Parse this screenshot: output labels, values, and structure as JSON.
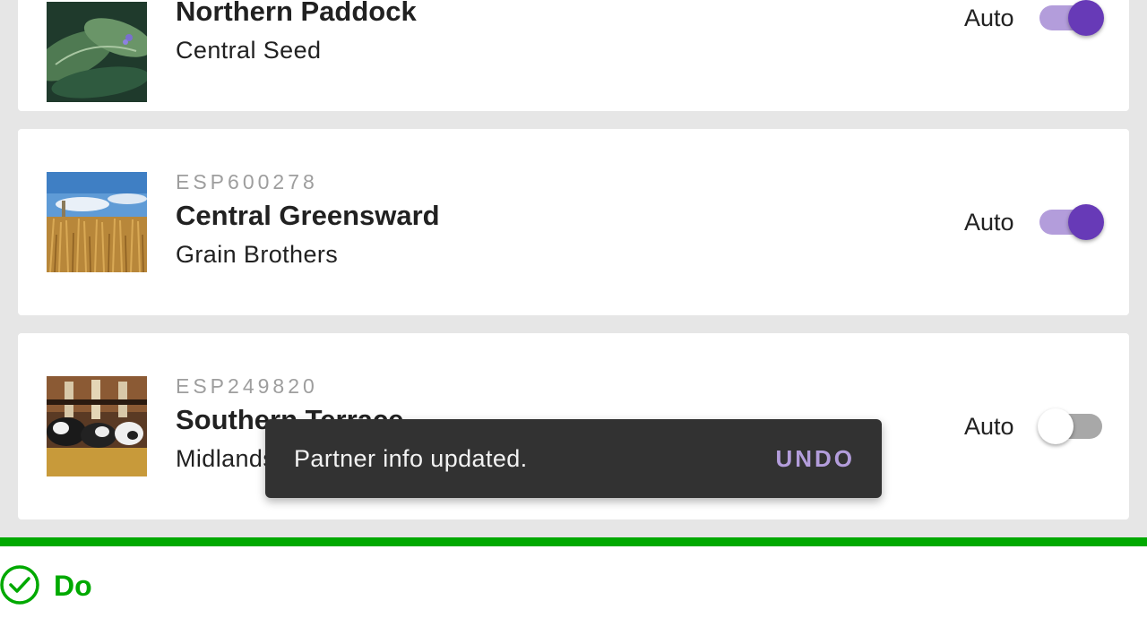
{
  "cards": [
    {
      "code": "",
      "name": "Northern Paddock",
      "company": "Central Seed",
      "auto_label": "Auto",
      "auto_on": true,
      "image": "seedling-leaves-photo"
    },
    {
      "code": "ESP600278",
      "name": "Central Greensward",
      "company": "Grain Brothers",
      "auto_label": "Auto",
      "auto_on": true,
      "image": "wheat-field-photo"
    },
    {
      "code": "ESP249820",
      "name": "Southern Terrace",
      "company": "Midlands",
      "auto_label": "Auto",
      "auto_on": false,
      "image": "dairy-cows-photo"
    }
  ],
  "snackbar": {
    "message": "Partner info updated.",
    "action": "UNDO"
  },
  "guideline": {
    "label": "Do",
    "icon": "check-circle-icon",
    "color": "#00a900"
  },
  "colors": {
    "switch_on_track": "#b39ddb",
    "switch_on_thumb": "#673ab7",
    "snackbar_bg": "#323232",
    "snackbar_action": "#b39ddb"
  }
}
